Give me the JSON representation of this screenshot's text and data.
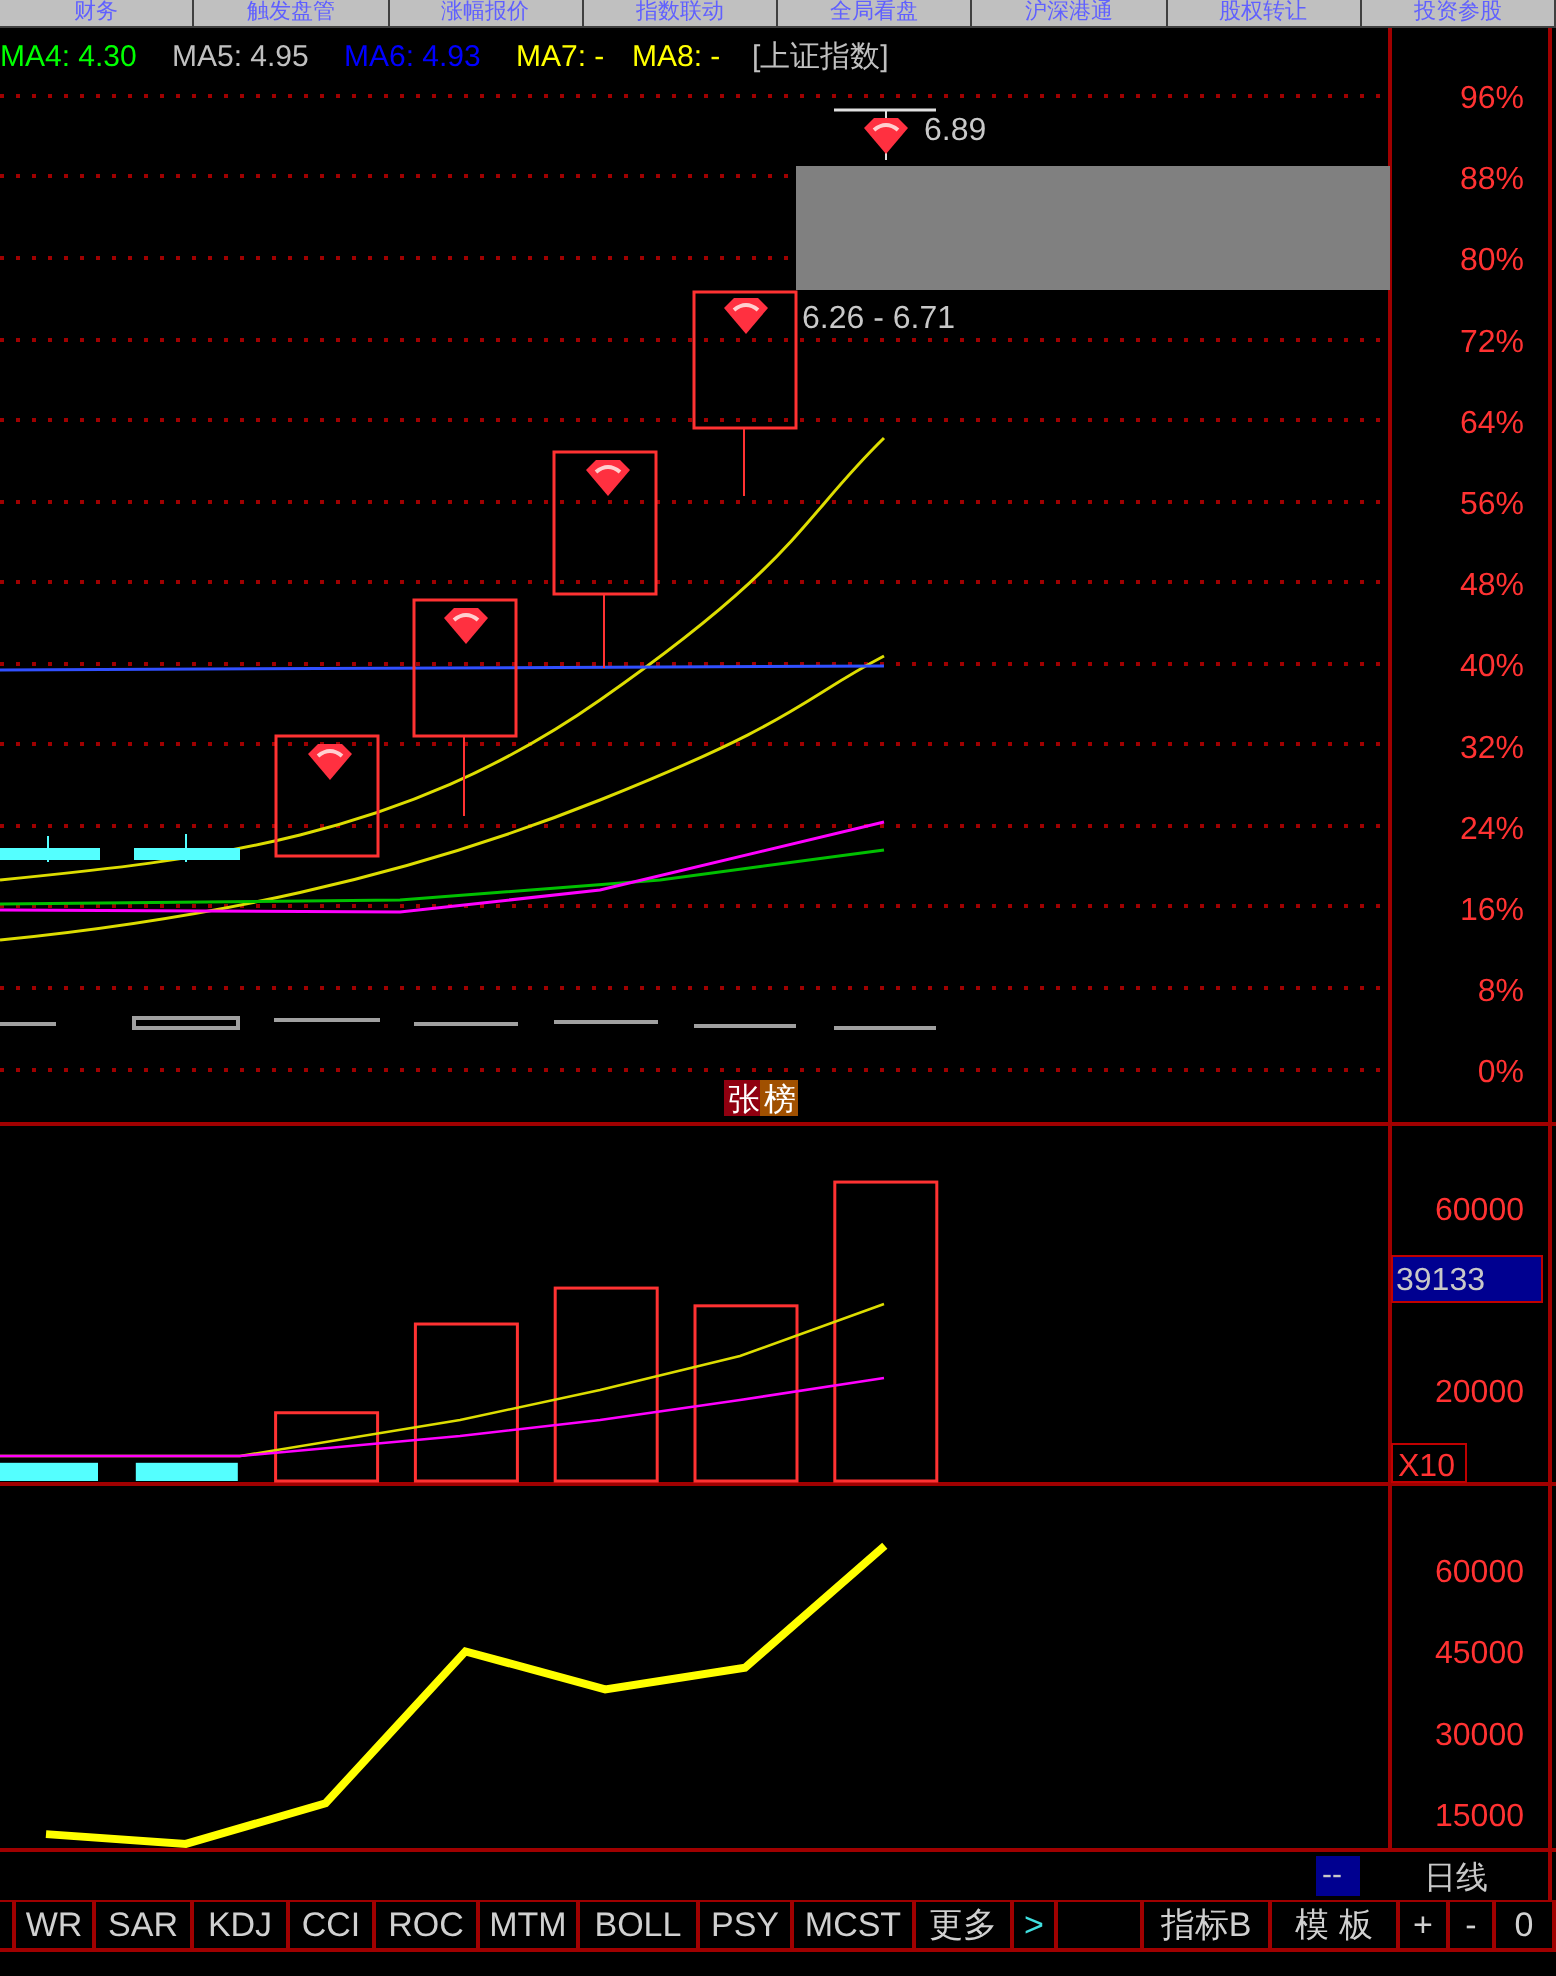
{
  "top_tabs": [
    "财务",
    "触发盘管",
    "涨幅报价",
    "指数联动",
    "全局看盘",
    "沪深港通",
    "股权转让",
    "投资参股"
  ],
  "legend": [
    {
      "label": "MA4: 4.30",
      "color": "#00ff00"
    },
    {
      "label": "MA5: 4.95",
      "color": "#c0c0c0"
    },
    {
      "label": "MA6: 4.93",
      "color": "#0000ff"
    },
    {
      "label": "MA7: -",
      "color": "#ffff00"
    },
    {
      "label": "MA8: -",
      "color": "#ffff00"
    },
    {
      "label": "[上证指数]",
      "color": "#c0c0c0"
    }
  ],
  "main_chart": {
    "ticks": [
      "96%",
      "88%",
      "80%",
      "72%",
      "64%",
      "56%",
      "48%",
      "40%",
      "32%",
      "24%",
      "16%",
      "8%",
      "0%"
    ],
    "high_label": "6.89",
    "range_label": "6.26 - 6.71",
    "badge": [
      "张",
      "榜"
    ]
  },
  "volume": {
    "axis_labels": [
      "60000",
      "20000"
    ],
    "value_box": "39133",
    "scale": "X10"
  },
  "indicator": {
    "axis_labels": [
      "60000",
      "45000",
      "30000",
      "15000"
    ]
  },
  "period": {
    "box": "--",
    "label": "日线"
  },
  "bottom_tabs": [
    {
      "label": "WR",
      "kind": "tab"
    },
    {
      "label": "SAR",
      "kind": "tab"
    },
    {
      "label": "KDJ",
      "kind": "tab"
    },
    {
      "label": "CCI",
      "kind": "tab"
    },
    {
      "label": "ROC",
      "kind": "tab"
    },
    {
      "label": "MTM",
      "kind": "tab"
    },
    {
      "label": "BOLL",
      "kind": "tab"
    },
    {
      "label": "PSY",
      "kind": "tab"
    },
    {
      "label": "MCST",
      "kind": "tab"
    },
    {
      "label": "更多",
      "kind": "tab"
    },
    {
      "label": ">",
      "kind": "arrow"
    },
    {
      "kind": "blank"
    },
    {
      "label": "指标B",
      "kind": "tab"
    },
    {
      "label": "模 板",
      "kind": "tab"
    },
    {
      "label": "+",
      "kind": "tab"
    },
    {
      "label": "-",
      "kind": "tab"
    },
    {
      "label": "0",
      "kind": "tab"
    }
  ]
}
